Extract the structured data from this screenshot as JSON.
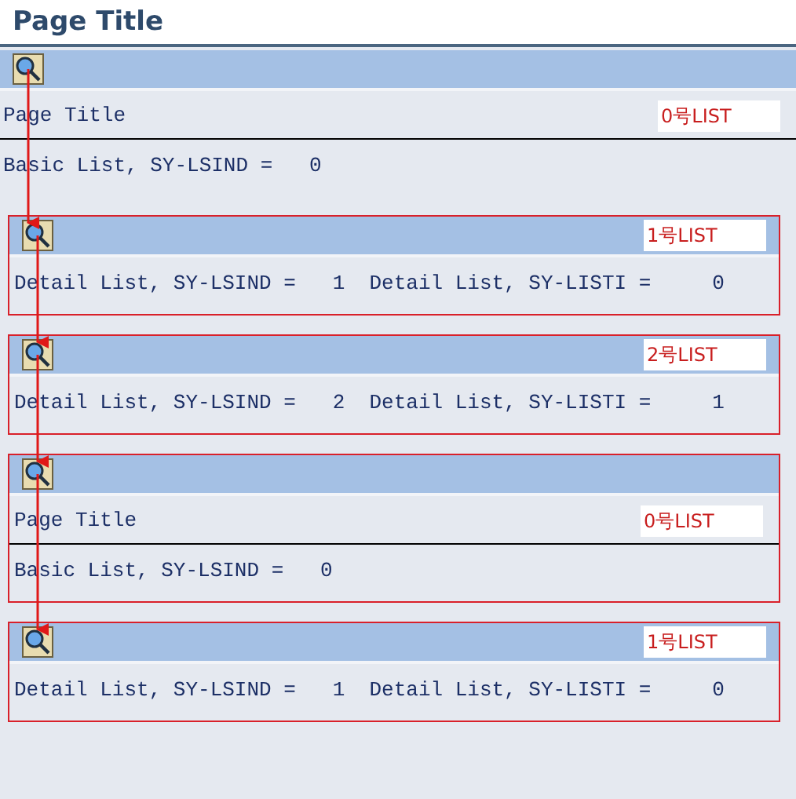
{
  "page_title": "Page Title",
  "lists": [
    {
      "kind": "basic",
      "framed": false,
      "tag": "0号LIST",
      "title": "Page Title",
      "lines": [
        "Basic List, SY-LSIND =   0"
      ]
    },
    {
      "kind": "detail",
      "framed": true,
      "tag": "1号LIST",
      "lines": [
        "Detail List, SY-LSIND =   1  Detail List, SY-LISTI =     0"
      ]
    },
    {
      "kind": "detail",
      "framed": true,
      "tag": "2号LIST",
      "lines": [
        "Detail List, SY-LSIND =   2  Detail List, SY-LISTI =     1"
      ]
    },
    {
      "kind": "basic",
      "framed": true,
      "tag": "0号LIST",
      "title": "Page Title",
      "lines": [
        "Basic List, SY-LSIND =   0"
      ]
    },
    {
      "kind": "detail",
      "framed": true,
      "tag": "1号LIST",
      "lines": [
        "Detail List, SY-LSIND =   1  Detail List, SY-LISTI =     0"
      ]
    }
  ]
}
